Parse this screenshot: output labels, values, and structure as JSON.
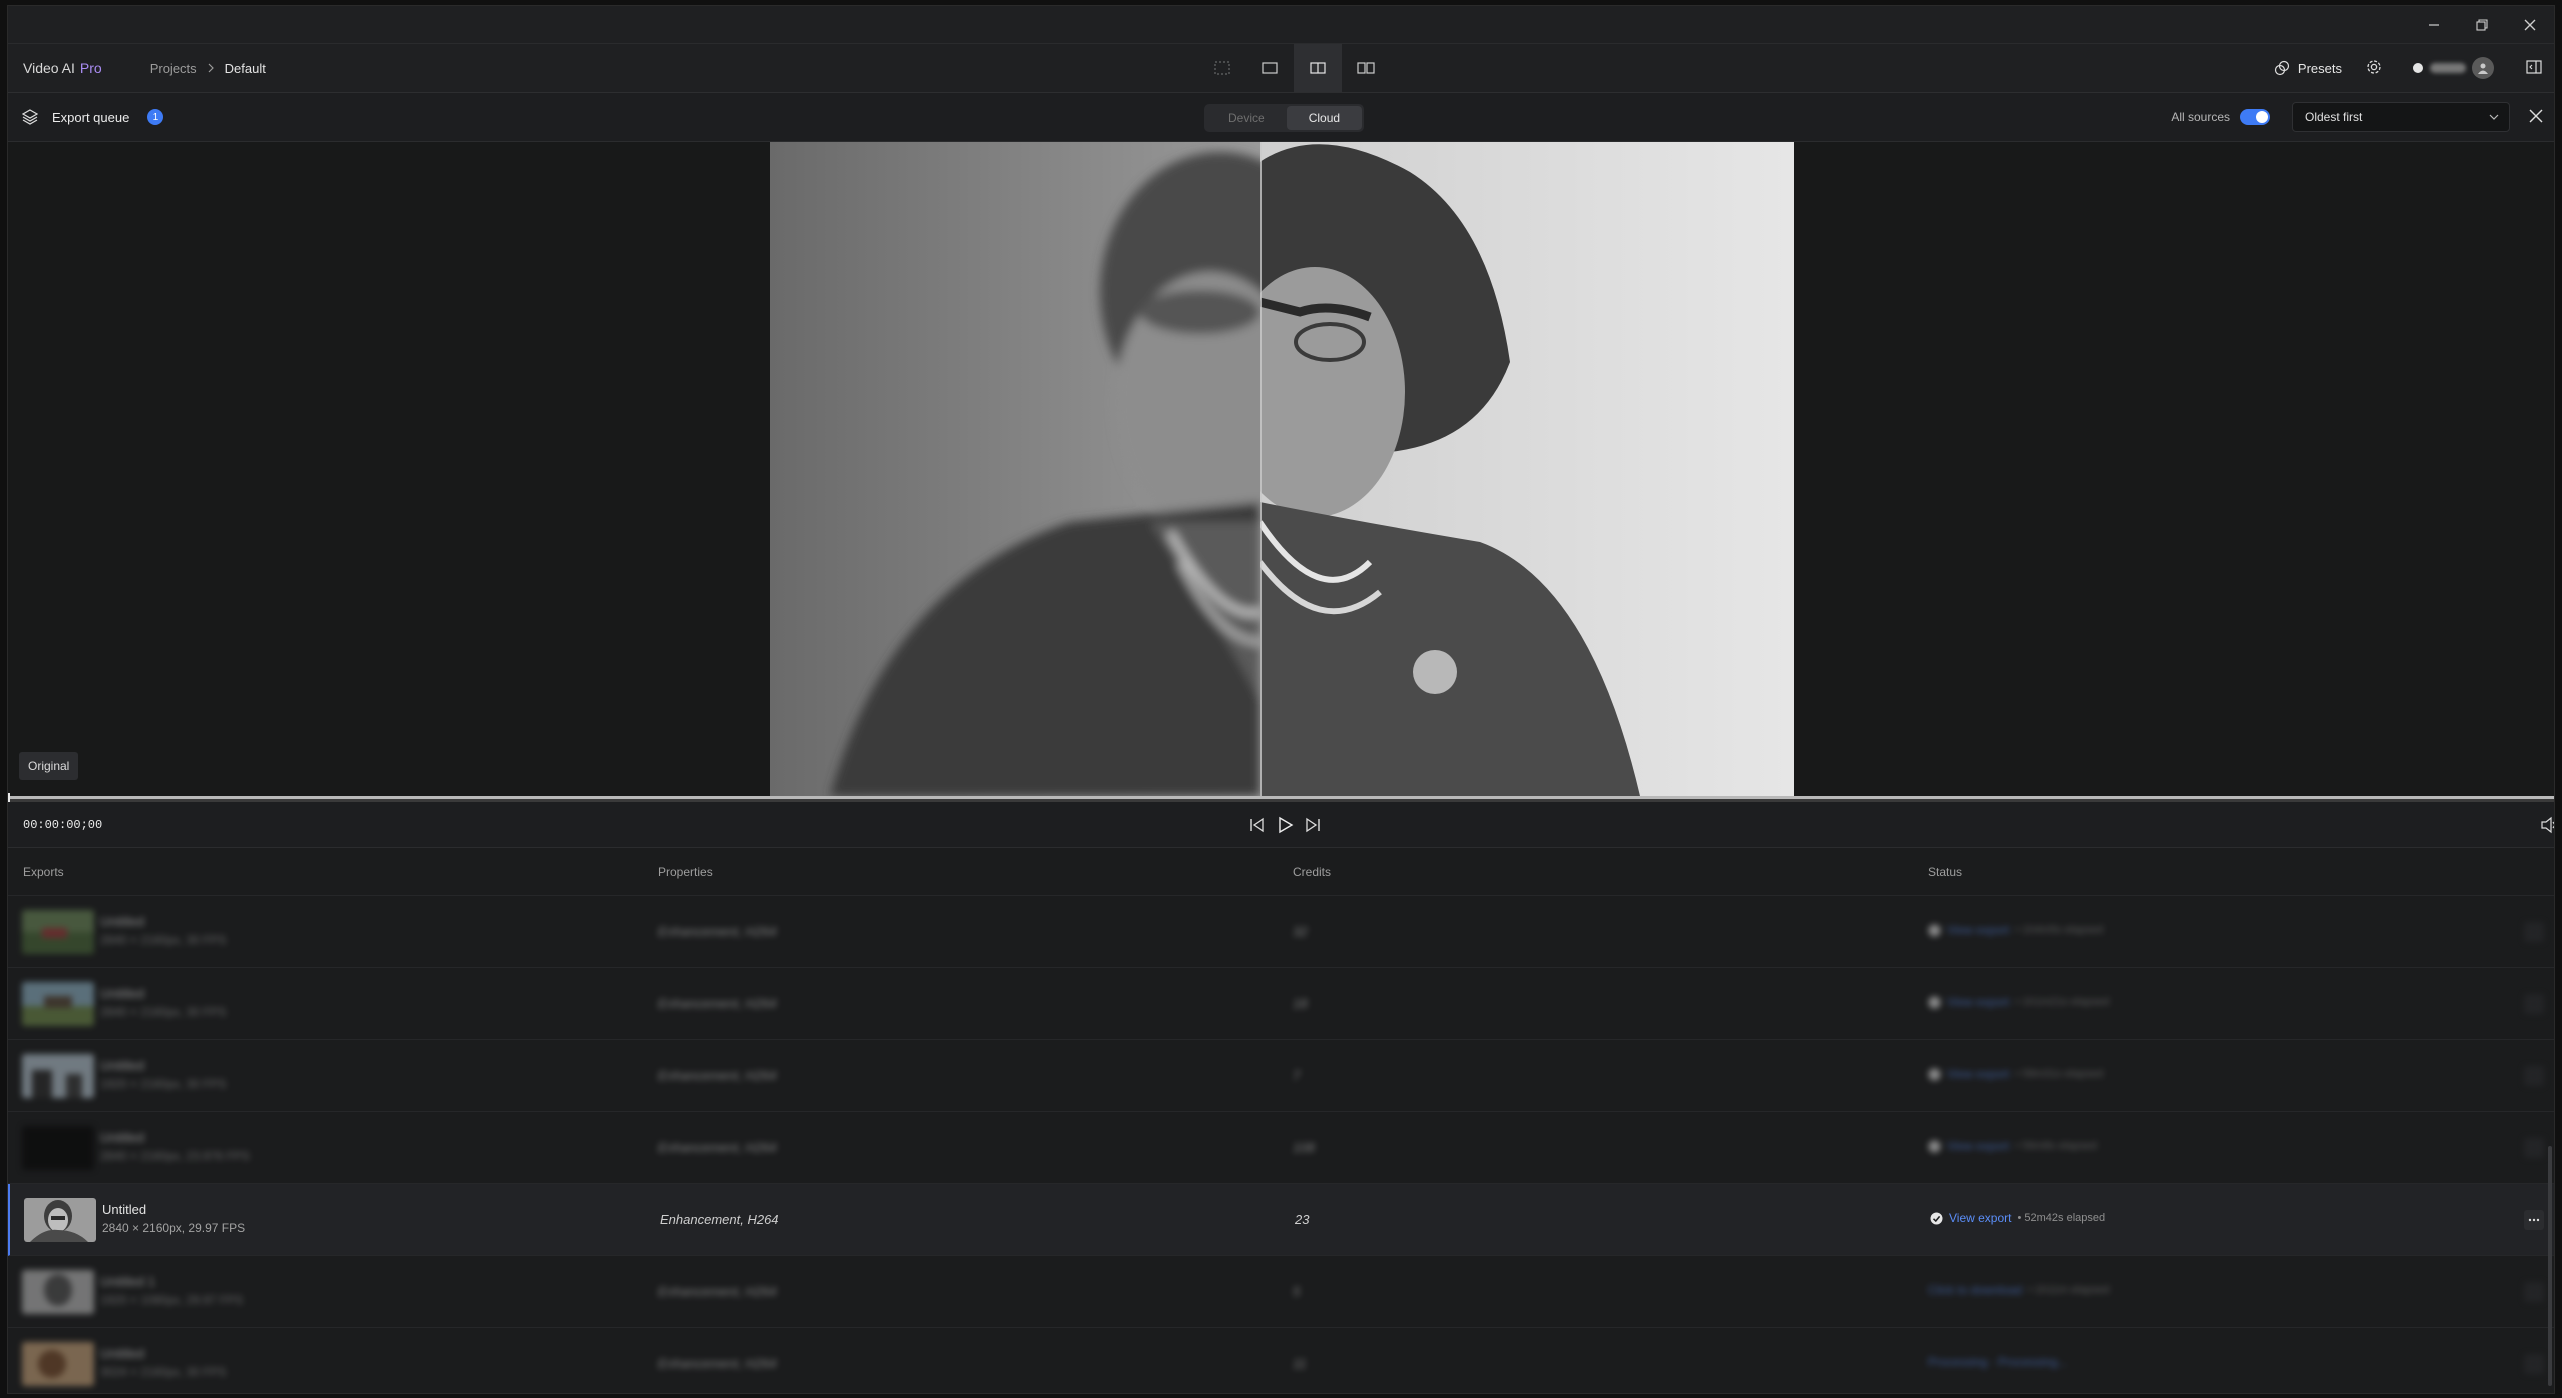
{
  "app": {
    "name": "Video AI",
    "edition": "Pro"
  },
  "breadcrumb": {
    "projects": "Projects",
    "current": "Default"
  },
  "header": {
    "presets_label": "Presets"
  },
  "queue": {
    "title": "Export queue",
    "count": "1",
    "segments": [
      "Device",
      "Cloud"
    ],
    "active_segment": "Cloud",
    "all_sources_label": "All sources",
    "all_sources_on": true,
    "sort_value": "Oldest first"
  },
  "preview": {
    "view_label": "Original"
  },
  "transport": {
    "timecode": "00:00:00;00",
    "progress": 0
  },
  "table": {
    "columns": [
      "Exports",
      "Properties",
      "Credits",
      "Status"
    ],
    "rows": [
      {
        "name": "Untitled",
        "meta": "2840 × 2160px, 30 FPS",
        "props": "Enhancement, H264",
        "credits": "32",
        "status_link": "View export",
        "elapsed": "• 1h4m5s elapsed",
        "blurred": true
      },
      {
        "name": "Untitled",
        "meta": "2840 × 2160px, 30 FPS",
        "props": "Enhancement, H264",
        "credits": "18",
        "status_link": "View export",
        "elapsed": "• 1h1m21s elapsed",
        "blurred": true
      },
      {
        "name": "Untitled",
        "meta": "1920 × 2160px, 30 FPS",
        "props": "Enhancement, H264",
        "credits": "7",
        "status_link": "View export",
        "elapsed": "• 58m31s elapsed",
        "blurred": true
      },
      {
        "name": "Untitled",
        "meta": "2840 × 2160px, 23.976 FPS",
        "props": "Enhancement, H264",
        "credits": "108",
        "status_link": "View export",
        "elapsed": "• 56m8s elapsed",
        "blurred": true
      },
      {
        "name": "Untitled",
        "meta": "2840 × 2160px, 29.97 FPS",
        "props": "Enhancement, H264",
        "credits": "23",
        "status_link": "View export",
        "elapsed": "• 52m42s elapsed",
        "blurred": false,
        "selected": true
      },
      {
        "name": "Untitled 1",
        "meta": "1920 × 1080px, 29.97 FPS",
        "props": "Enhancement, H264",
        "credits": "5",
        "status_link": "Click to download",
        "elapsed": "• 1h11m elapsed",
        "blurred": true
      },
      {
        "name": "Untitled",
        "meta": "3024 × 2160px, 30 FPS",
        "props": "Enhancement, H264",
        "credits": "11",
        "status_link": "Processing · Processing...",
        "elapsed": "",
        "blurred": true
      }
    ]
  },
  "colors": {
    "accent": "#3e7bf5",
    "link": "#5b8ef8",
    "brand_pro": "#a98cf2"
  }
}
